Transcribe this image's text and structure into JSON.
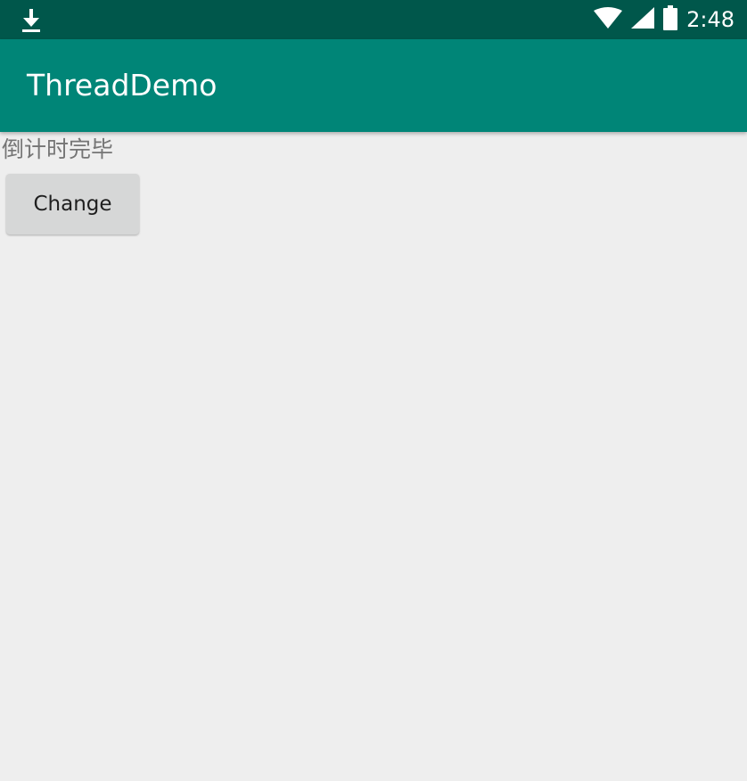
{
  "status_bar": {
    "time": "2:48",
    "icons": [
      "download-icon",
      "wifi-icon",
      "signal-icon",
      "battery-icon"
    ]
  },
  "app_bar": {
    "title": "ThreadDemo"
  },
  "main": {
    "status_text": "倒计时完毕",
    "change_button_label": "Change"
  },
  "colors": {
    "status_bar": "#00574B",
    "app_bar": "#008577",
    "background": "#EEEEEE",
    "button": "#D6D7D7"
  }
}
